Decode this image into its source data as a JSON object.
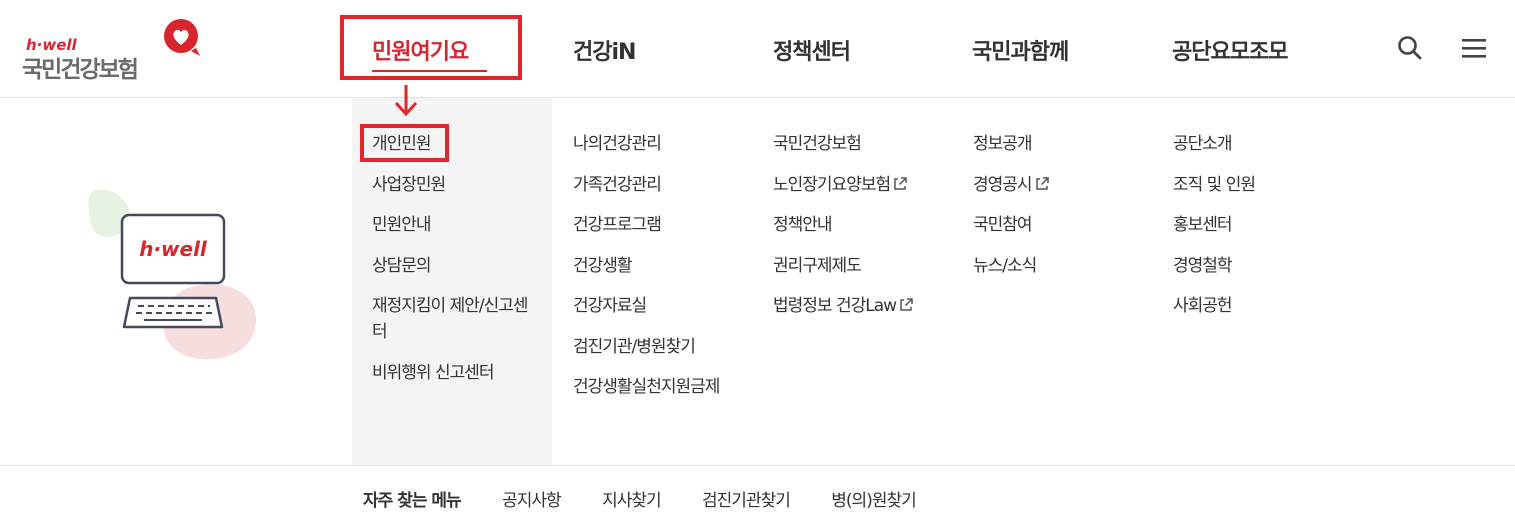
{
  "logo": {
    "tagline": "h·well",
    "name": "국민건강보험"
  },
  "nav": {
    "items": [
      {
        "label": "민원여기요"
      },
      {
        "label": "건강iN"
      },
      {
        "label": "정책센터"
      },
      {
        "label": "국민과함께"
      },
      {
        "label": "공단요모조모"
      }
    ]
  },
  "illustration": {
    "screen_text": "h·well"
  },
  "menu": {
    "col1": [
      {
        "label": "개인민원"
      },
      {
        "label": "사업장민원"
      },
      {
        "label": "민원안내"
      },
      {
        "label": "상담문의"
      },
      {
        "label": "재정지킴이 제안/신고센터"
      },
      {
        "label": "비위행위 신고센터"
      }
    ],
    "col2": [
      {
        "label": "나의건강관리"
      },
      {
        "label": "가족건강관리"
      },
      {
        "label": "건강프로그램"
      },
      {
        "label": "건강생활"
      },
      {
        "label": "건강자료실"
      },
      {
        "label": "검진기관/병원찾기"
      },
      {
        "label": "건강생활실천지원금제"
      }
    ],
    "col3": [
      {
        "label": "국민건강보험"
      },
      {
        "label": "노인장기요양보험"
      },
      {
        "label": "정책안내"
      },
      {
        "label": "권리구제제도"
      },
      {
        "label": "법령정보 건강Law"
      }
    ],
    "col4": [
      {
        "label": "정보공개"
      },
      {
        "label": "경영공시"
      },
      {
        "label": "국민참여"
      },
      {
        "label": "뉴스/소식"
      }
    ],
    "col5": [
      {
        "label": "공단소개"
      },
      {
        "label": "조직 및 인원"
      },
      {
        "label": "홍보센터"
      },
      {
        "label": "경영철학"
      },
      {
        "label": "사회공헌"
      }
    ]
  },
  "quick_menu": {
    "title": "자주 찾는 메뉴",
    "links": [
      {
        "label": "공지사항"
      },
      {
        "label": "지사찾기"
      },
      {
        "label": "검진기관찾기"
      },
      {
        "label": "병(의)원찾기"
      }
    ]
  },
  "colors": {
    "accent": "#d8262f",
    "annotation": "#e3262b",
    "text": "#333333",
    "shade": "#f4f4f4"
  },
  "icons": {
    "search": "search-icon",
    "menu": "hamburger-menu-icon",
    "external": "external-link-icon"
  }
}
